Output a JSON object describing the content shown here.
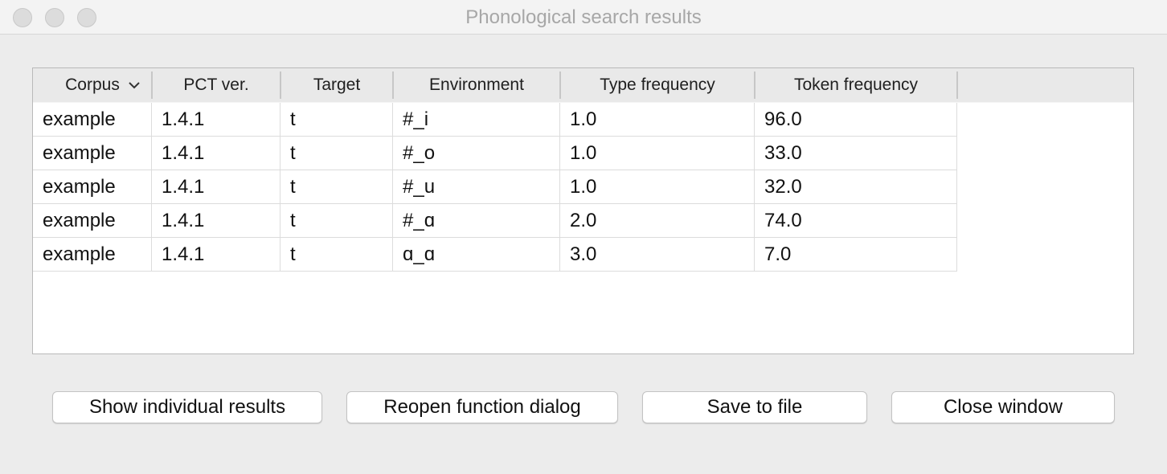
{
  "window": {
    "title": "Phonological search results"
  },
  "table": {
    "columns": [
      {
        "label": "Corpus"
      },
      {
        "label": "PCT ver."
      },
      {
        "label": "Target"
      },
      {
        "label": "Environment"
      },
      {
        "label": "Type frequency"
      },
      {
        "label": "Token frequency"
      }
    ],
    "rows": [
      [
        "example",
        "1.4.1",
        "t",
        "#_i",
        "1.0",
        "96.0"
      ],
      [
        "example",
        "1.4.1",
        "t",
        "#_o",
        "1.0",
        "33.0"
      ],
      [
        "example",
        "1.4.1",
        "t",
        "#_u",
        "1.0",
        "32.0"
      ],
      [
        "example",
        "1.4.1",
        "t",
        "#_ɑ",
        "2.0",
        "74.0"
      ],
      [
        "example",
        "1.4.1",
        "t",
        "ɑ_ɑ",
        "3.0",
        "7.0"
      ]
    ]
  },
  "buttons": {
    "show_individual": "Show individual results",
    "reopen_dialog": "Reopen function dialog",
    "save_file": "Save to file",
    "close_window": "Close window"
  }
}
